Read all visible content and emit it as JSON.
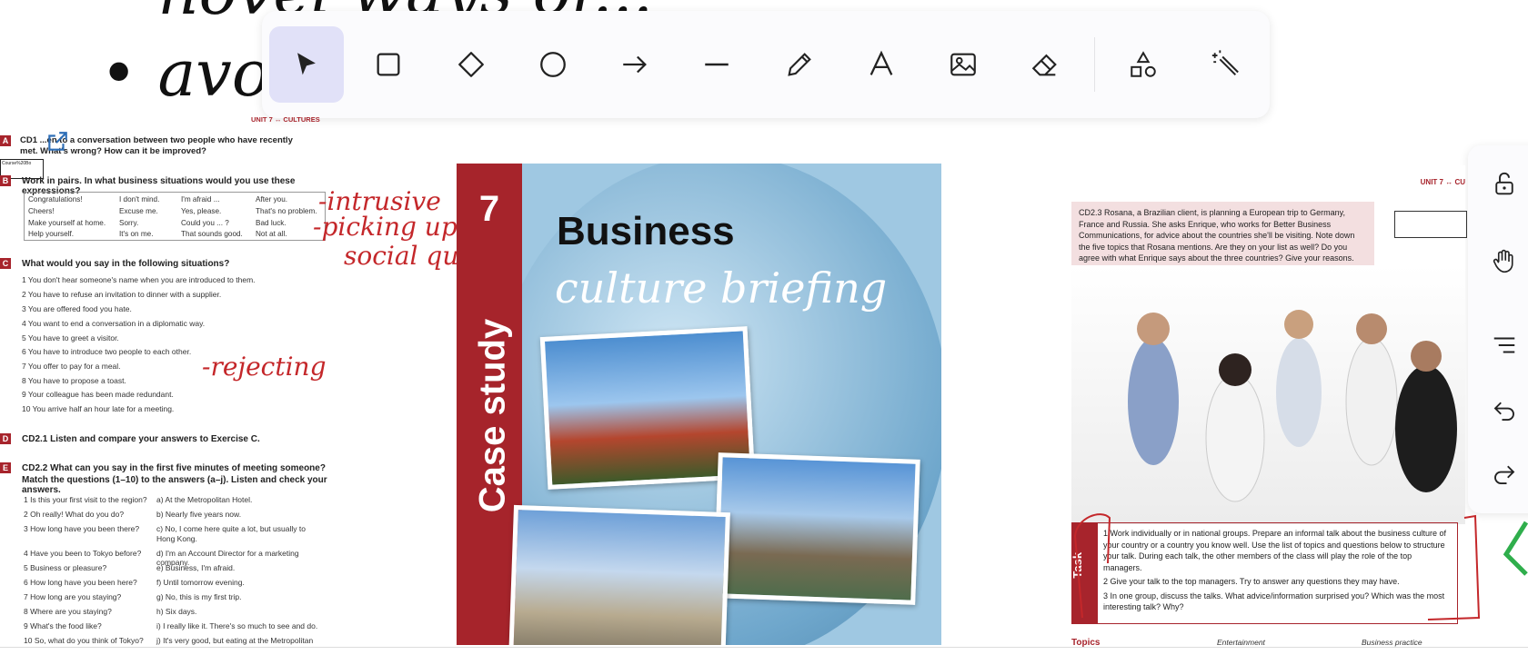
{
  "toolbar": {
    "tools": [
      {
        "name": "select-tool",
        "icon": "cursor-icon",
        "active": true
      },
      {
        "name": "rectangle-tool",
        "icon": "square-icon"
      },
      {
        "name": "diamond-tool",
        "icon": "diamond-icon"
      },
      {
        "name": "ellipse-tool",
        "icon": "circle-icon"
      },
      {
        "name": "arrow-tool",
        "icon": "arrow-right-icon"
      },
      {
        "name": "line-tool",
        "icon": "line-icon"
      },
      {
        "name": "pencil-tool",
        "icon": "pencil-icon"
      },
      {
        "name": "text-tool",
        "icon": "text-a-icon"
      },
      {
        "name": "image-tool",
        "icon": "image-icon"
      },
      {
        "name": "eraser-tool",
        "icon": "eraser-icon"
      },
      {
        "name": "shapes-tool",
        "icon": "shapes-icon"
      },
      {
        "name": "magic-tool",
        "icon": "magic-wand-icon"
      }
    ],
    "accent": "#e1e1f8"
  },
  "sidebar": {
    "buttons": [
      "lock-open-icon",
      "hand-icon",
      "menu-icon",
      "undo-icon",
      "redo-icon"
    ]
  },
  "handwriting": {
    "top": "• novel ways of...",
    "avoid": "• avoic",
    "intrusive": "-intrusive",
    "picking": "-picking up on",
    "social": "social queues-",
    "rejecting": "-rejecting"
  },
  "worksheet": {
    "header": "UNIT 7 ↔ CULTURES",
    "link_label": "Course%20Bo",
    "qA": "CD1  ...en to a conversation between two people who have recently met. What's wrong? How can it be improved?",
    "qB": "Work in pairs. In what business situations would you use these expressions?",
    "expressions": [
      [
        "Congratulations!",
        "I don't mind.",
        "I'm afraid ...",
        "After you."
      ],
      [
        "Cheers!",
        "Excuse me.",
        "Yes, please.",
        "That's no problem."
      ],
      [
        "Make yourself at home.",
        "Sorry.",
        "Could you ... ?",
        "Bad luck."
      ],
      [
        "Help yourself.",
        "It's on me.",
        "That sounds good.",
        "Not at all."
      ]
    ],
    "qC": "What would you say in the following situations?",
    "situations": [
      "1  You don't hear someone's name when you are introduced to them.",
      "2  You have to refuse an invitation to dinner with a supplier.",
      "3  You are offered food you hate.",
      "4  You want to end a conversation in a diplomatic way.",
      "5  You have to greet a visitor.",
      "6  You have to introduce two people to each other.",
      "7  You offer to pay for a meal.",
      "8  You have to propose a toast.",
      "9  Your colleague has been made redundant.",
      "10 You arrive half an hour late for a meeting."
    ],
    "qD": "CD2.1 Listen and compare your answers to Exercise C.",
    "qE": "CD2.2 What can you say in the first five minutes of meeting someone?",
    "qE2": "Match the questions (1–10) to the answers (a–j). Listen and check your answers.",
    "questions": [
      "1  Is this your first visit to the region?",
      "2  Oh really! What do you do?",
      "3  How long have you been there?",
      "4  Have you been to Tokyo before?",
      "5  Business or pleasure?",
      "6  How long have you been here?",
      "7  How long are you staying?",
      "8  Where are you staying?",
      "9  What's the food like?",
      "10 So, what do you think of Tokyo?"
    ],
    "answers": [
      "a)  At the Metropolitan Hotel.",
      "b)  Nearly five years now.",
      "c)  No, I come here quite a lot, but usually to",
      "     Hong Kong.",
      "d)  I'm an Account Director for a marketing company.",
      "e)  Business, I'm afraid.",
      "f)  Until tomorrow evening.",
      "g)  No, this is my first trip.",
      "h)  Six days.",
      "i)  I really like it. There's so much to see and do.",
      "j)  It's very good, but eating at the Metropolitan"
    ],
    "letters": [
      "A",
      "B",
      "C",
      "D",
      "E"
    ]
  },
  "book": {
    "number": "7",
    "band_text": "Case study",
    "title": "Business",
    "subtitle": "culture briefing"
  },
  "right_page": {
    "header": "UNIT 7 ↔ CU",
    "intro": "CD2.3 Rosana, a Brazilian client, is planning a European trip to Germany, France and Russia. She asks Enrique, who works for Better Business Communications, for advice about the countries she'll be visiting. Note down the five topics that Rosana mentions. Are they on your list as well? Do you agree with what Enrique says about the three countries? Give your reasons.",
    "task_tag": "Task",
    "task_items": [
      "1  Work individually or in national groups. Prepare an informal talk about the business culture of your country or a country you know well. Use the list of topics and questions below to structure your talk. During each talk, the other members of the class will play the role of the top managers.",
      "2  Give your talk to the top managers. Try to answer any questions they may have.",
      "3  In one group, discuss the talks. What advice/information surprised you? Which was the most interesting talk? Why?"
    ],
    "topics": "Topics",
    "col2": "Entertainment",
    "col3": "Business practice"
  }
}
